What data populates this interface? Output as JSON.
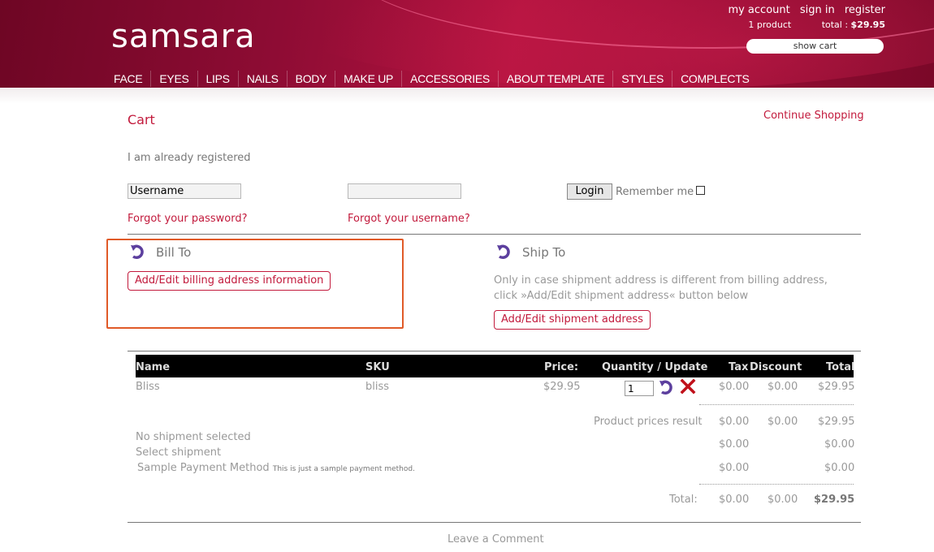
{
  "header": {
    "logo": "samsara",
    "links": [
      "my account",
      "sign in",
      "register"
    ],
    "cart_count": "1 product",
    "cart_total_label": "total :",
    "cart_total_value": "$29.95",
    "show_cart": "show cart",
    "nav": [
      "FACE",
      "EYES",
      "LIPS",
      "NAILS",
      "BODY",
      "MAKE UP",
      "ACCESSORIES",
      "ABOUT TEMPLATE",
      "STYLES",
      "COMPLECTS"
    ]
  },
  "page": {
    "title": "Cart",
    "continue": "Continue Shopping"
  },
  "login": {
    "registered": "I am already registered",
    "username_value": "Username",
    "password_value": "",
    "button": "Login",
    "remember": "Remember me",
    "forgot_password": "Forgot your password?",
    "forgot_username": "Forgot your username?"
  },
  "bill": {
    "title": "Bill To",
    "button": "Add/Edit billing address information"
  },
  "ship": {
    "title": "Ship To",
    "note": "Only in case shipment address is different from billing address, click »Add/Edit shipment address« button below",
    "button": "Add/Edit shipment address"
  },
  "table": {
    "headers": {
      "name": "Name",
      "sku": "SKU",
      "price": "Price:",
      "qty": "Quantity / Update",
      "tax": "Tax",
      "discount": "Discount",
      "total": "Total"
    },
    "row": {
      "name": "Bliss",
      "sku": "bliss",
      "price": "$29.95",
      "qty": "1",
      "tax": "$0.00",
      "discount": "$0.00",
      "total": "$29.95"
    },
    "product_result": {
      "label": "Product prices result",
      "tax": "$0.00",
      "discount": "$0.00",
      "total": "$29.95"
    },
    "shipment": {
      "label1": "No shipment selected",
      "label2": "Select shipment",
      "tax": "$0.00",
      "total": "$0.00"
    },
    "payment": {
      "label": "Sample Payment Method",
      "note": "This is just a sample payment method.",
      "tax": "$0.00",
      "total": "$0.00"
    },
    "grand": {
      "label": "Total:",
      "tax": "$0.00",
      "discount": "$0.00",
      "total": "$29.95"
    }
  },
  "footer": {
    "comment": "Leave a Comment"
  },
  "colors": {
    "brand": "#8e0c34",
    "link": "#c21a3c",
    "highlight": "#e05a28"
  }
}
